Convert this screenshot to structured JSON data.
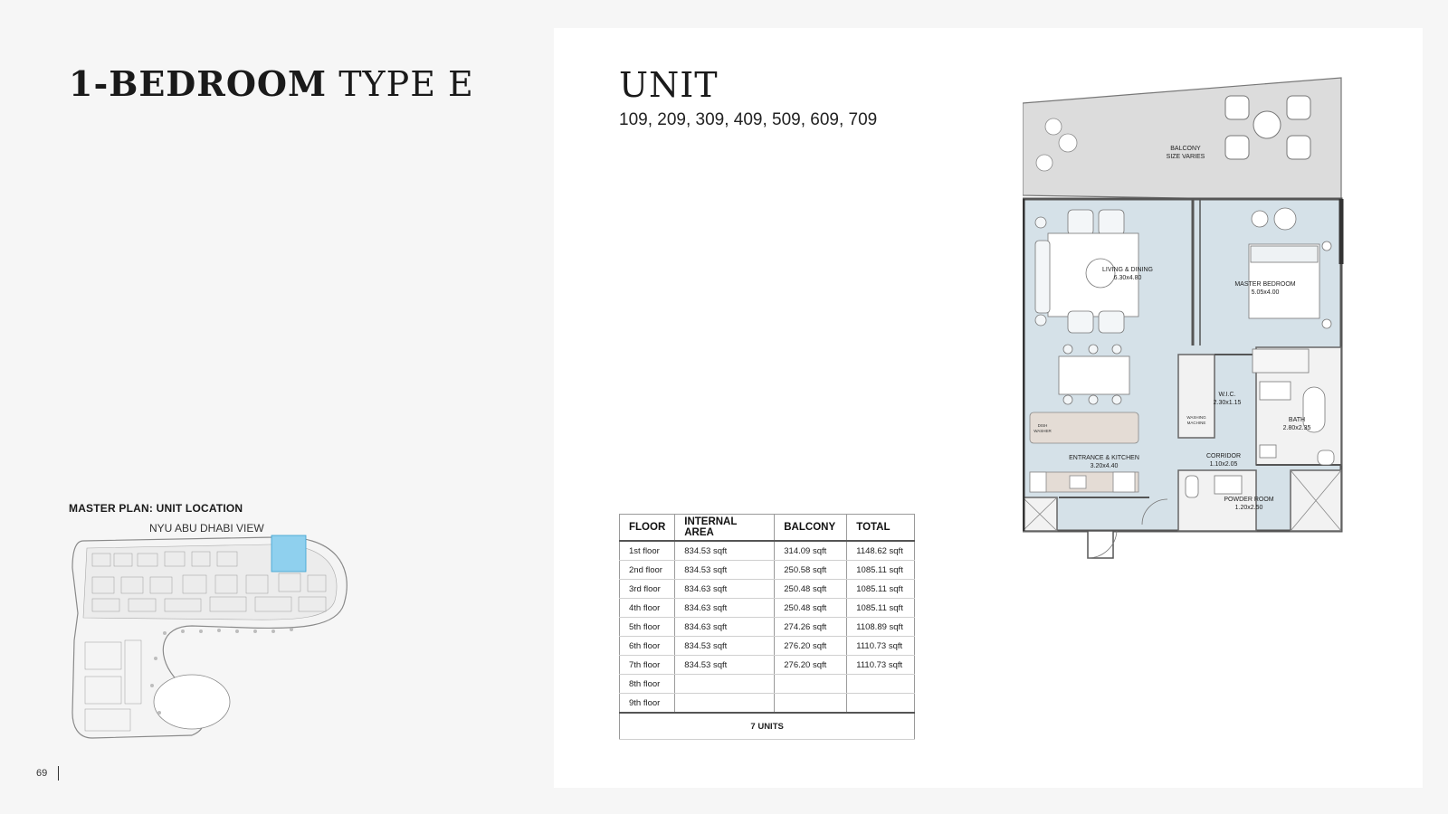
{
  "title": {
    "bold": "1-BEDROOM",
    "light": "TYPE E"
  },
  "unit": {
    "heading": "UNIT",
    "numbers": "109, 209, 309, 409, 509, 609, 709"
  },
  "master_plan": {
    "label": "MASTER PLAN: UNIT LOCATION",
    "view": "NYU ABU DHABI VIEW"
  },
  "table": {
    "headers": [
      "FLOOR",
      "INTERNAL AREA",
      "BALCONY",
      "TOTAL"
    ],
    "rows": [
      [
        "1st floor",
        "834.53 sqft",
        "314.09 sqft",
        "1148.62 sqft"
      ],
      [
        "2nd floor",
        "834.53 sqft",
        "250.58 sqft",
        "1085.11 sqft"
      ],
      [
        "3rd floor",
        "834.63 sqft",
        "250.48 sqft",
        "1085.11 sqft"
      ],
      [
        "4th floor",
        "834.63 sqft",
        "250.48 sqft",
        "1085.11 sqft"
      ],
      [
        "5th floor",
        "834.63 sqft",
        "274.26 sqft",
        "1108.89 sqft"
      ],
      [
        "6th floor",
        "834.53 sqft",
        "276.20 sqft",
        "1110.73 sqft"
      ],
      [
        "7th floor",
        "834.53 sqft",
        "276.20 sqft",
        "1110.73 sqft"
      ],
      [
        "8th floor",
        "",
        "",
        ""
      ],
      [
        "9th floor",
        "",
        "",
        ""
      ]
    ],
    "total": "7 UNITS"
  },
  "floorplan": {
    "balcony_1": "BALCONY",
    "balcony_2": "SIZE VARIES",
    "living_1": "LIVING & DINING",
    "living_2": "6.30x4.80",
    "master_1": "MASTER BEDROOM",
    "master_2": "5.05x4.00",
    "wic_1": "W.I.C.",
    "wic_2": "2.30x1.15",
    "bath_1": "BATH",
    "bath_2": "2.80x2.35",
    "corridor_1": "CORRIDOR",
    "corridor_2": "1.10x2.05",
    "kitchen_1": "ENTRANCE & KITCHEN",
    "kitchen_2": "3.20x4.40",
    "powder_1": "POWDER ROOM",
    "powder_2": "1.20x2.50",
    "dishwasher_1": "DISH",
    "dishwasher_2": "WASHER",
    "washing_1": "WASHING",
    "washing_2": "MACHINE"
  },
  "page_number": "69",
  "colors": {
    "room_fill": "#d5e1e8",
    "balcony_fill": "#dcdcdc",
    "highlight": "#8fd0ee",
    "wall": "#555555"
  }
}
